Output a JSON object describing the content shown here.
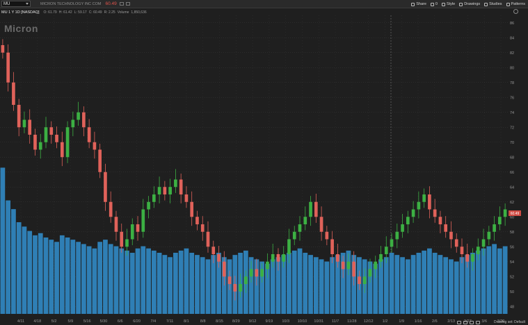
{
  "toolbar": {
    "symbol_value": "MU",
    "company_name": "MICRON TECHNOLOGY INC COM",
    "last_price": "60.49",
    "items": [
      {
        "label": "Share",
        "icon": "share-icon"
      },
      {
        "label": "0",
        "icon": "alert-icon"
      },
      {
        "label": "Style",
        "icon": "style-icon"
      },
      {
        "label": "Drawings",
        "icon": "pencil-icon"
      },
      {
        "label": "Studies",
        "icon": "studies-icon"
      },
      {
        "label": "Patterns",
        "icon": "patterns-icon"
      }
    ]
  },
  "info": {
    "ticker_line": "MU 1 Y 1D [NASDAQ]",
    "open": "O: 61.79",
    "high": "H: 61.42",
    "low": "L: 59.17",
    "close": "C: 60.49",
    "change": "R: 2.25",
    "volume_label": "Volume",
    "volume_value": "1,850,636"
  },
  "logo_text": "Micron",
  "footer": {
    "drawing_set": "Drawing set: Default"
  },
  "colors": {
    "up": "#3cb043",
    "down": "#e0625a",
    "volume": "#2f7fb5",
    "grid": "#3a3a3a",
    "background": "#1f1f1f",
    "price_tag": "#d04b43"
  },
  "chart_data": {
    "type": "candlestick",
    "x_ticks": [
      "4/11",
      "4/18",
      "5/2",
      "5/9",
      "5/16",
      "5/30",
      "6/6",
      "6/20",
      "7/4",
      "7/11",
      "8/1",
      "8/8",
      "8/15",
      "8/29",
      "9/12",
      "9/19",
      "10/3",
      "10/10",
      "10/31",
      "11/7",
      "11/28",
      "12/12",
      "1/2",
      "1/9",
      "1/16",
      "2/6",
      "2/13",
      "2/27",
      "3/6",
      "3/20"
    ],
    "y_ticks": [
      48,
      50,
      52,
      54,
      56,
      58,
      60,
      62,
      64,
      66,
      68,
      70,
      72,
      74,
      76,
      78,
      80,
      82,
      84,
      86
    ],
    "ylim": [
      47,
      87
    ],
    "last_price_label": "60.49",
    "series_close": [
      82,
      78,
      75,
      72,
      73,
      71,
      69,
      70,
      72,
      71,
      70,
      68,
      72,
      73,
      74,
      72,
      70,
      69,
      66,
      62,
      60,
      58,
      56,
      57,
      59,
      58,
      61,
      62,
      63,
      64,
      63,
      64,
      65,
      63,
      62,
      60,
      59,
      58,
      56,
      55,
      54,
      52,
      51,
      50,
      51,
      52,
      53,
      52,
      53,
      54,
      55,
      54,
      55,
      57,
      58,
      59,
      60,
      62,
      60,
      58,
      57,
      55,
      54,
      53,
      54,
      52,
      51,
      52,
      53,
      54,
      55,
      56,
      57,
      58,
      59,
      60,
      61,
      62,
      63,
      61,
      60,
      59,
      58,
      57,
      56,
      55,
      54,
      55,
      56,
      57,
      58,
      59,
      60,
      61
    ],
    "volume": [
      67,
      52,
      48,
      42,
      40,
      38,
      36,
      37,
      35,
      34,
      33,
      36,
      35,
      34,
      33,
      32,
      31,
      30,
      33,
      34,
      32,
      31,
      30,
      29,
      28,
      30,
      31,
      30,
      29,
      28,
      27,
      26,
      28,
      29,
      30,
      28,
      27,
      26,
      25,
      27,
      28,
      26,
      25,
      27,
      28,
      29,
      26,
      25,
      24,
      23,
      25,
      26,
      27,
      28,
      29,
      30,
      28,
      27,
      26,
      25,
      24,
      26,
      27,
      28,
      29,
      27,
      26,
      25,
      24,
      23,
      25,
      26,
      28,
      27,
      26,
      25,
      27,
      28,
      29,
      30,
      28,
      27,
      26,
      25,
      24,
      26,
      27,
      28,
      29,
      30,
      31,
      32,
      30,
      31
    ]
  }
}
